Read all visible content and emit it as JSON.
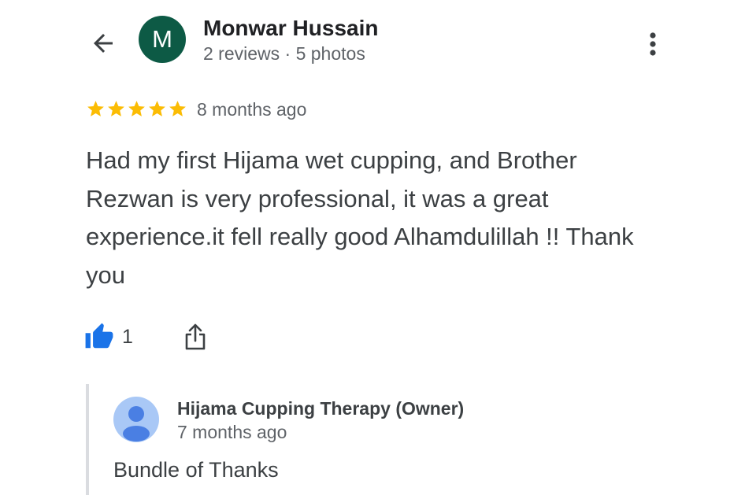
{
  "review": {
    "author": {
      "initial": "M",
      "name": "Monwar Hussain",
      "meta": "2 reviews · 5 photos",
      "avatar_color": "#0d5a45"
    },
    "rating": 5,
    "rating_max": 5,
    "star_color": "#fbbc04",
    "time": "8 months ago",
    "text": "Had my first Hijama wet cupping, and Brother Rezwan is very professional, it was a great experience.it fell really good Alhamdulillah !! Thank you",
    "likes": "1",
    "icons": {
      "back": "arrow-back-icon",
      "more": "more-vert-icon",
      "like": "thumb-up-icon",
      "share": "share-icon",
      "owner_avatar": "person-icon"
    }
  },
  "owner_reply": {
    "name": "Hijama Cupping Therapy (Owner)",
    "time": "7 months ago",
    "text": "Bundle of Thanks",
    "avatar_color": "#a9c8f6",
    "icon_color": "#4a7fe3"
  },
  "colors": {
    "accent_blue": "#1a73e8",
    "secondary_text": "#5f6368",
    "divider": "#dadce0"
  }
}
